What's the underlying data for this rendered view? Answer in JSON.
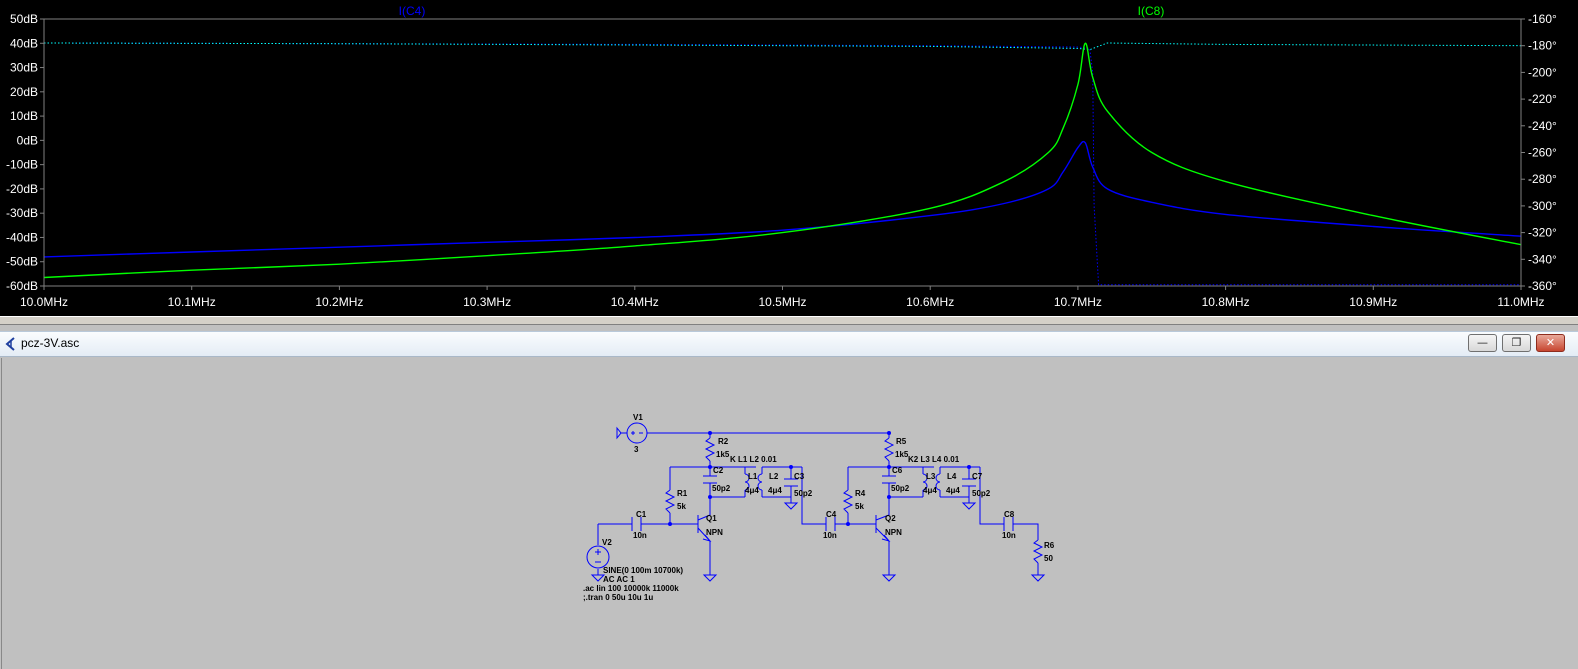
{
  "plot": {
    "traces": [
      {
        "label": "I(C4)",
        "color": "#0000ff"
      },
      {
        "label": "I(C8)",
        "color": "#00ff00"
      }
    ],
    "colors": {
      "background": "#000000",
      "axis": "#808080",
      "text": "#ffffff"
    }
  },
  "chart_data": {
    "type": "line",
    "x_label": "frequency",
    "x_ticks": [
      "10.0MHz",
      "10.1MHz",
      "10.2MHz",
      "10.3MHz",
      "10.4MHz",
      "10.5MHz",
      "10.6MHz",
      "10.7MHz",
      "10.8MHz",
      "10.9MHz",
      "11.0MHz"
    ],
    "xlim_mhz": [
      10.0,
      11.0
    ],
    "y_left_ticks": [
      "50dB",
      "40dB",
      "30dB",
      "20dB",
      "10dB",
      "0dB",
      "-10dB",
      "-20dB",
      "-30dB",
      "-40dB",
      "-50dB",
      "-60dB"
    ],
    "ylim_left_db": [
      -60,
      50
    ],
    "y_right_ticks": [
      "-160°",
      "-180°",
      "-200°",
      "-220°",
      "-240°",
      "-260°",
      "-280°",
      "-300°",
      "-320°",
      "-340°",
      "-360°"
    ],
    "ylim_right_deg": [
      -360,
      -160
    ],
    "series": [
      {
        "name": "I(C4)",
        "color": "#0000ff",
        "x_mhz": [
          10.0,
          10.1,
          10.2,
          10.3,
          10.4,
          10.5,
          10.6,
          10.65,
          10.68,
          10.69,
          10.7,
          10.705,
          10.71,
          10.72,
          10.75,
          10.8,
          10.9,
          11.0
        ],
        "magnitude_db": [
          -48,
          -46,
          -44,
          -42,
          -40,
          -37,
          -31,
          -26,
          -20,
          -13,
          -3,
          -1,
          -11,
          -20,
          -25.5,
          -30.5,
          -35.5,
          -39.5
        ]
      },
      {
        "name": "I(C8)",
        "color": "#00ff00",
        "x_mhz": [
          10.0,
          10.1,
          10.2,
          10.3,
          10.4,
          10.5,
          10.6,
          10.65,
          10.68,
          10.69,
          10.7,
          10.705,
          10.71,
          10.72,
          10.75,
          10.8,
          10.9,
          11.0
        ],
        "magnitude_db": [
          -56.5,
          -53.5,
          -51,
          -47.5,
          -43.5,
          -38,
          -28,
          -17,
          -5,
          5,
          23,
          40,
          26,
          12,
          -5,
          -17,
          -31,
          -43
        ]
      }
    ],
    "phase_series": [
      {
        "name": "I(C4) phase",
        "color": "#0000ff",
        "x_mhz": [
          10.0,
          10.2,
          10.4,
          10.6,
          10.7,
          10.708,
          10.71,
          10.711,
          10.714,
          11.0
        ],
        "phase_deg": [
          -178,
          -178.5,
          -179,
          -180,
          -181,
          -182,
          -200,
          -300,
          -359,
          -359
        ]
      },
      {
        "name": "I(C8) phase",
        "color": "#00ffff",
        "x_mhz": [
          10.0,
          10.2,
          10.4,
          10.6,
          10.7,
          10.708,
          10.715,
          10.72,
          10.8,
          11.0
        ],
        "phase_deg": [
          -178,
          -178.5,
          -179.5,
          -180.5,
          -182,
          -183,
          -180,
          -178,
          -179,
          -180
        ]
      }
    ]
  },
  "schematic_window": {
    "title": "pcz-3V.asc",
    "buttons": {
      "minimize": "—",
      "restore": "❐",
      "close": "✕"
    }
  },
  "schematic": {
    "labels": {
      "v1": "V1",
      "v1_val": "3",
      "r2": "R2",
      "r2_val": "1k5",
      "r5": "R5",
      "r5_val": "1k5",
      "k1": "K L1 L2 0.01",
      "k2": "K2 L3 L4 0.01",
      "c2": "C2",
      "c2_val": "50p2",
      "l1": "L1",
      "l1_val": "4μ4",
      "l2": "L2",
      "l2_val": "4μ4",
      "c3": "C3",
      "c3_val": "50p2",
      "c6": "C6",
      "c6_val": "50p2",
      "l3": "L3",
      "l3_val": "4μ4",
      "l4": "L4",
      "l4_val": "4μ4",
      "c7": "C7",
      "c7_val": "50p2",
      "r1": "R1",
      "r1_val": "5k",
      "r4": "R4",
      "r4_val": "5k",
      "c1": "C1",
      "c1_val": "10n",
      "c4": "C4",
      "c4_val": "10n",
      "c8": "C8",
      "c8_val": "10n",
      "q1": "Q1",
      "q1_val": "NPN",
      "q2": "Q2",
      "q2_val": "NPN",
      "v2": "V2",
      "v2_val1": "SINE(0 100m 10700k)",
      "v2_val2": "AC AC 1",
      "r6": "R6",
      "r6_val": "50",
      "cmd_ac": ".ac lin 100 10000k 11000k",
      "cmd_tran": ";.tran 0 50u 10u 1u"
    },
    "colors": {
      "wire": "#0000ff",
      "text": "#000000",
      "background": "#c0c0c0"
    }
  }
}
